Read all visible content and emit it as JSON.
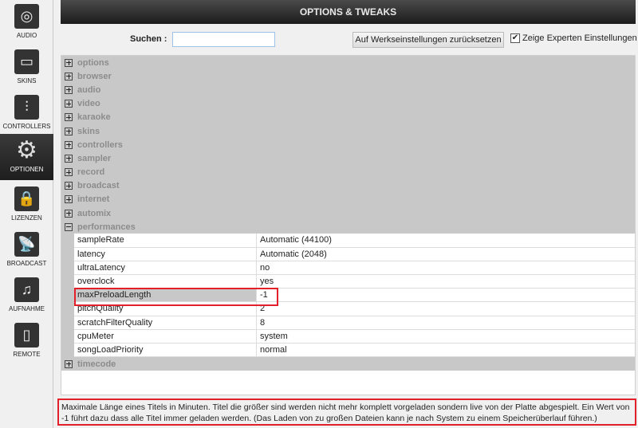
{
  "sidebar": {
    "items": [
      {
        "label": "AUDIO",
        "icon": "speaker-icon",
        "glyph": "◎"
      },
      {
        "label": "SKINS",
        "icon": "monitor-icon",
        "glyph": "▭"
      },
      {
        "label": "CONTROLLERS",
        "icon": "sliders-icon",
        "glyph": "⫶"
      },
      {
        "label": "OPTIONEN",
        "icon": "gear-icon",
        "glyph": "⚙",
        "selected": true
      },
      {
        "label": "LIZENZEN",
        "icon": "lock-icon",
        "glyph": "🔒"
      },
      {
        "label": "BROADCAST",
        "icon": "antenna-icon",
        "glyph": "📡"
      },
      {
        "label": "AUFNAHME",
        "icon": "music-folder-icon",
        "glyph": "♫"
      },
      {
        "label": "REMOTE",
        "icon": "tablet-icon",
        "glyph": "▯"
      }
    ]
  },
  "header": {
    "title": "OPTIONS & TWEAKS"
  },
  "toolbar": {
    "search_label": "Suchen :",
    "search_value": "",
    "reset_label": "Auf Werkseinstellungen zurücksetzen",
    "expert_label": "Zeige Experten Einstellungen",
    "expert_checked": true
  },
  "tree": {
    "groups_before": [
      "options",
      "browser",
      "audio",
      "video",
      "karaoke",
      "skins",
      "controllers",
      "sampler",
      "record",
      "broadcast",
      "internet",
      "automix"
    ],
    "expanded": "performances",
    "rows": [
      {
        "name": "sampleRate",
        "value": "Automatic (44100)"
      },
      {
        "name": "latency",
        "value": "Automatic (2048)"
      },
      {
        "name": "ultraLatency",
        "value": "no"
      },
      {
        "name": "overclock",
        "value": "yes"
      },
      {
        "name": "maxPreloadLength",
        "value": "-1",
        "selected": true
      },
      {
        "name": "pitchQuality",
        "value": "2"
      },
      {
        "name": "scratchFilterQuality",
        "value": "8"
      },
      {
        "name": "cpuMeter",
        "value": "system"
      },
      {
        "name": "songLoadPriority",
        "value": "normal"
      }
    ],
    "groups_after": [
      "timecode"
    ]
  },
  "description": "Maximale Länge eines Titels in Minuten. Titel die größer sind werden nicht mehr komplett vorgeladen sondern live von der Platte abgespielt. Ein Wert von -1 führt dazu dass alle Titel immer geladen werden. (Das Laden von zu großen Dateien kann je nach System zu einem Speicherüberlauf führen.)",
  "colors": {
    "highlight": "#e3202a",
    "group_bg": "#c8c8c8",
    "header_bg": "#2a2a2a"
  }
}
